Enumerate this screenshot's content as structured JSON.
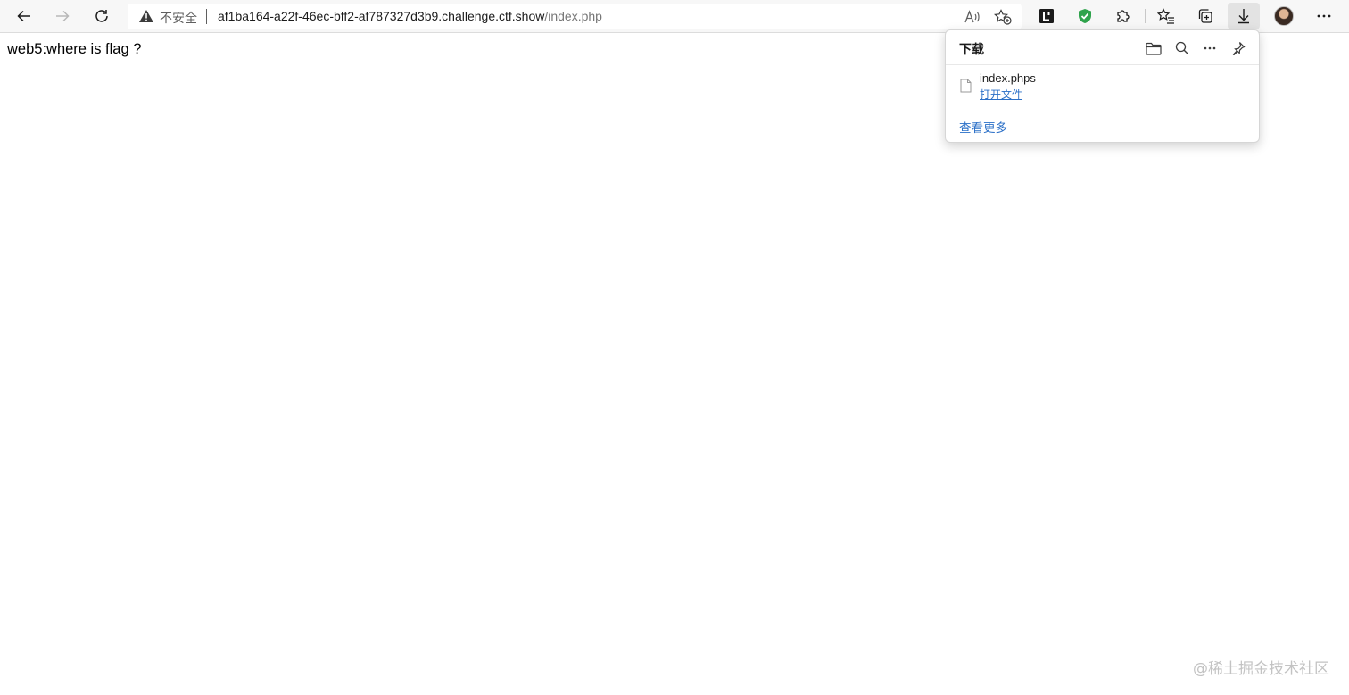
{
  "browser": {
    "address_bar": {
      "security_label": "不安全",
      "url_host": "af1ba164-a22f-46ec-bff2-af787327d3b9.challenge.ctf.show",
      "url_path": "/index.php"
    },
    "icons": {
      "back": "back-arrow-icon",
      "forward": "forward-arrow-icon",
      "refresh": "refresh-icon",
      "warning": "warning-triangle-icon",
      "read_aloud": "read-aloud-icon",
      "add_favorite": "add-favorite-icon",
      "extension_1": "extension-l-icon",
      "extension_2": "shield-check-icon",
      "extensions": "puzzle-icon",
      "favorites": "favorites-icon",
      "collections": "collections-icon",
      "downloads": "download-icon",
      "profile": "avatar",
      "more": "more-icon"
    },
    "colors": {
      "toolbar_bg": "#f7f7f7",
      "link": "#2a6fc7",
      "shield_green": "#2fa34c"
    }
  },
  "page": {
    "text": "web5:where is flag ?"
  },
  "downloads_panel": {
    "title": "下载",
    "items": [
      {
        "file_name": "index.phps",
        "action_label": "打开文件"
      }
    ],
    "see_more_label": "查看更多"
  },
  "watermark": "@稀土掘金技术社区"
}
